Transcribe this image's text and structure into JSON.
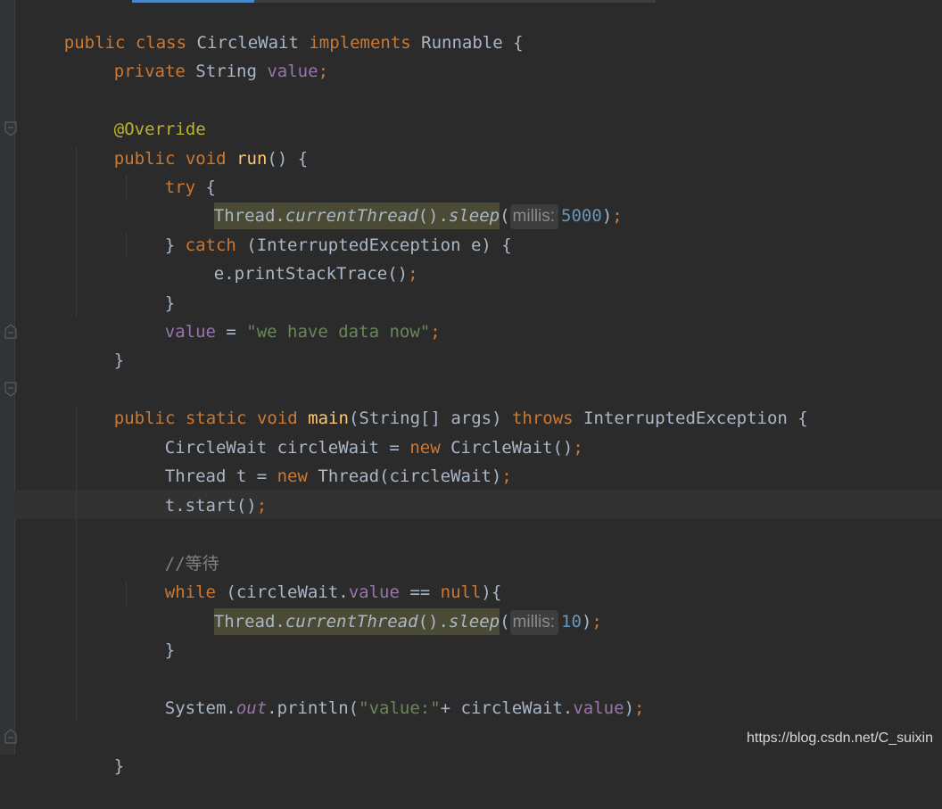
{
  "editor": {
    "theme_colors": {
      "background": "#2b2b2b",
      "keyword": "#cc7832",
      "field": "#9876aa",
      "string": "#6a8759",
      "number": "#6897bb",
      "annotation": "#bbb529",
      "method_decl": "#ffc66d",
      "comment": "#808080",
      "plain": "#a9b7c6"
    },
    "code": {
      "l1": {
        "a": "public",
        "b": " ",
        "c": "class",
        "d": " CircleWait ",
        "e": "implements",
        "f": " Runnable {"
      },
      "l2": {
        "a": "private",
        "b": " String ",
        "c": "value",
        "d": ";"
      },
      "l4": {
        "a": "@Override"
      },
      "l5": {
        "a": "public",
        "b": " ",
        "c": "void",
        "d": " ",
        "e": "run",
        "f": "() {"
      },
      "l6": {
        "a": "try",
        "b": " {"
      },
      "l7": {
        "a": "Thread.",
        "b": "currentThread",
        "c": "().",
        "d": "sleep",
        "e": "(",
        "hint": "millis:",
        "num": "5000",
        "g": ")",
        "h": ";"
      },
      "l8": {
        "a": "} ",
        "b": "catch",
        "c": " (InterruptedException e) {"
      },
      "l9": {
        "a": "e.printStackTrace()",
        "b": ";"
      },
      "l10": {
        "a": "}"
      },
      "l11": {
        "a": "value",
        "b": " = ",
        "c": "\"we have data now\"",
        "d": ";"
      },
      "l12": {
        "a": "}"
      },
      "l14": {
        "a": "public",
        "b": " ",
        "c": "static",
        "d": " ",
        "e": "void",
        "f": " ",
        "g": "main",
        "h": "(String[] args) ",
        "i": "throws",
        "j": " InterruptedException {"
      },
      "l15": {
        "a": "CircleWait circleWait = ",
        "b": "new",
        "c": " CircleWait()",
        "d": ";"
      },
      "l16": {
        "a": "Thread t = ",
        "b": "new",
        "c": " Thread(circleWait)",
        "d": ";"
      },
      "l17": {
        "a": "t.start()",
        "b": ";"
      },
      "l19": {
        "a": "//等待"
      },
      "l20": {
        "a": "while",
        "b": " (circleWait.",
        "c": "value",
        "d": " == ",
        "e": "null",
        "f": "){"
      },
      "l21": {
        "a": "Thread.",
        "b": "currentThread",
        "c": "().",
        "d": "sleep",
        "e": "(",
        "hint": "millis:",
        "num": "10",
        "g": ")",
        "h": ";"
      },
      "l22": {
        "a": "}"
      },
      "l24": {
        "a": "System.",
        "b": "out",
        "c": ".println(",
        "d": "\"value:\"",
        "e": "+ circleWait.",
        "f": "value",
        "g": ")",
        "h": ";"
      },
      "l26": {
        "a": "}"
      }
    }
  },
  "watermark": "https://blog.csdn.net/C_suixin"
}
